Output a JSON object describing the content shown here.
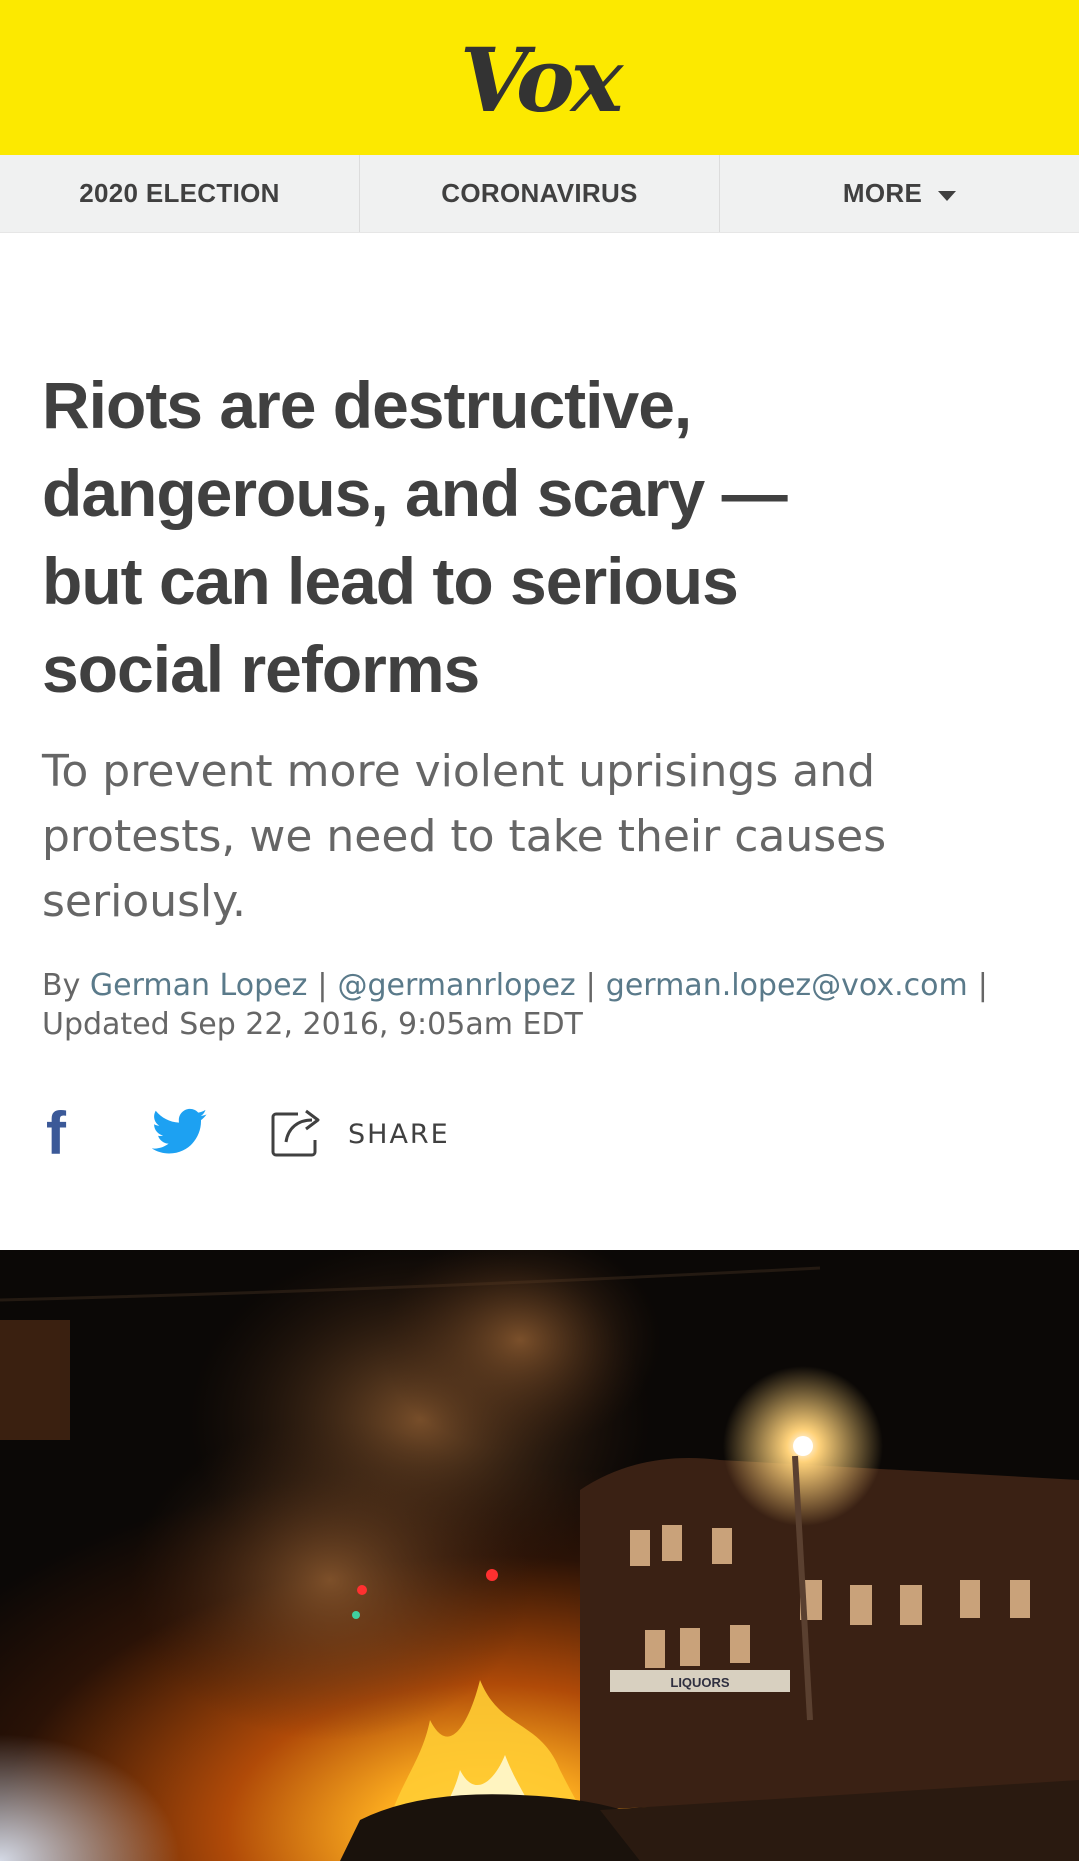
{
  "header": {
    "logo": "Vox",
    "brand_color": "#fce900"
  },
  "nav": {
    "items": [
      {
        "label": "2020 ELECTION"
      },
      {
        "label": "CORONAVIRUS"
      },
      {
        "label": "MORE"
      }
    ]
  },
  "article": {
    "headline": "Riots are destructive, dangerous, and scary — but can lead to serious social reforms",
    "dek": "To prevent more violent uprisings and protests, we need to take their causes seriously.",
    "byline": {
      "prefix": "By",
      "author": "German Lopez",
      "twitter": "@germanrlopez",
      "email": "german.lopez@vox.com",
      "updated": "Updated Sep 22, 2016, 9:05am EDT"
    }
  },
  "share": {
    "facebook_icon": "facebook-icon",
    "twitter_icon": "twitter-icon",
    "share_icon": "share-arrow-icon",
    "share_label": "SHARE",
    "facebook_color": "#3b5998",
    "twitter_color": "#1da1f2"
  },
  "hero_image": {
    "description": "night street scene with burning car and smoke",
    "sign_text": "LIQUORS"
  }
}
